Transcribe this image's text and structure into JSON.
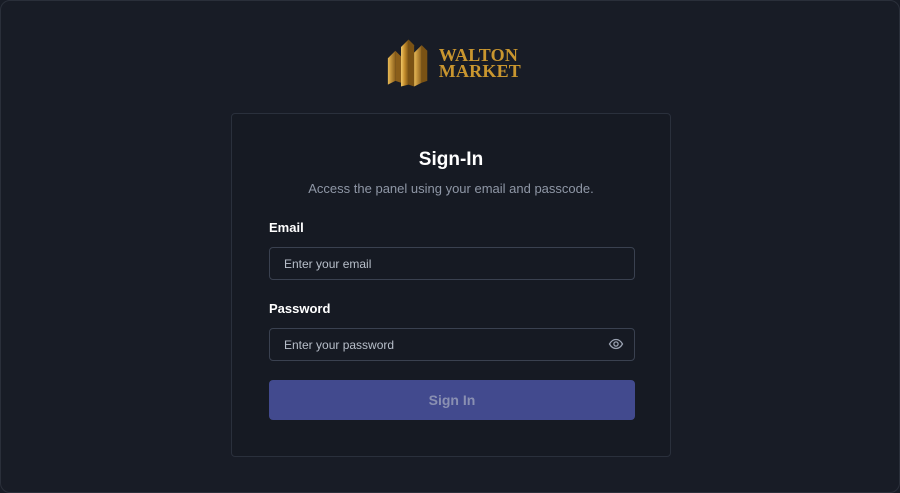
{
  "brand": {
    "line1": "WALTON",
    "line2": "MARKET",
    "icon": "walton-market-logo-icon",
    "color": "#c9962f"
  },
  "signin": {
    "title": "Sign-In",
    "subtitle": "Access the panel using your email and passcode.",
    "email_label": "Email",
    "email_placeholder": "Enter your email",
    "email_value": "",
    "password_label": "Password",
    "password_placeholder": "Enter your password",
    "password_value": "",
    "password_toggle_icon": "eye-icon",
    "submit_label": "Sign In"
  },
  "colors": {
    "background": "#181c26",
    "card": "#161a23",
    "button": "#424a8e",
    "button_text": "#8a90b2"
  }
}
